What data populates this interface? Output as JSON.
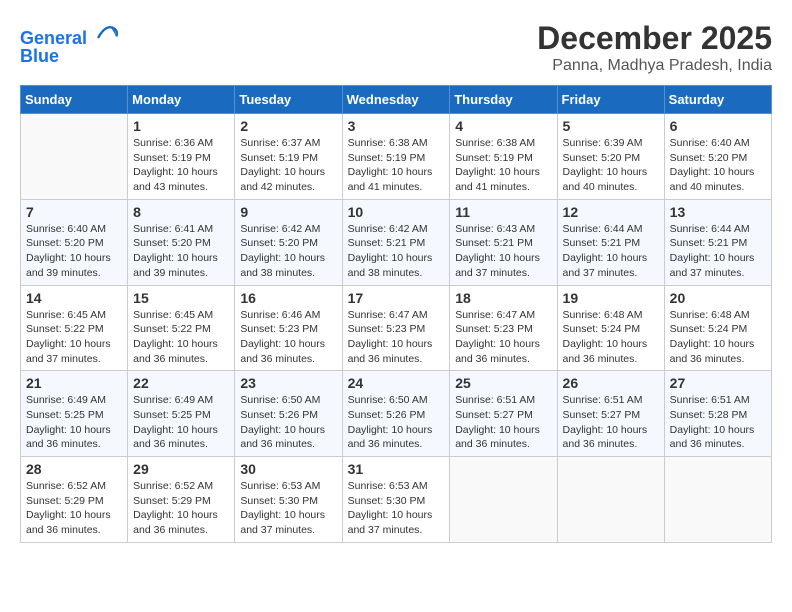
{
  "header": {
    "logo_line1": "General",
    "logo_line2": "Blue",
    "month": "December 2025",
    "location": "Panna, Madhya Pradesh, India"
  },
  "days_of_week": [
    "Sunday",
    "Monday",
    "Tuesday",
    "Wednesday",
    "Thursday",
    "Friday",
    "Saturday"
  ],
  "weeks": [
    [
      {
        "day": "",
        "info": ""
      },
      {
        "day": "1",
        "info": "Sunrise: 6:36 AM\nSunset: 5:19 PM\nDaylight: 10 hours\nand 43 minutes."
      },
      {
        "day": "2",
        "info": "Sunrise: 6:37 AM\nSunset: 5:19 PM\nDaylight: 10 hours\nand 42 minutes."
      },
      {
        "day": "3",
        "info": "Sunrise: 6:38 AM\nSunset: 5:19 PM\nDaylight: 10 hours\nand 41 minutes."
      },
      {
        "day": "4",
        "info": "Sunrise: 6:38 AM\nSunset: 5:19 PM\nDaylight: 10 hours\nand 41 minutes."
      },
      {
        "day": "5",
        "info": "Sunrise: 6:39 AM\nSunset: 5:20 PM\nDaylight: 10 hours\nand 40 minutes."
      },
      {
        "day": "6",
        "info": "Sunrise: 6:40 AM\nSunset: 5:20 PM\nDaylight: 10 hours\nand 40 minutes."
      }
    ],
    [
      {
        "day": "7",
        "info": "Sunrise: 6:40 AM\nSunset: 5:20 PM\nDaylight: 10 hours\nand 39 minutes."
      },
      {
        "day": "8",
        "info": "Sunrise: 6:41 AM\nSunset: 5:20 PM\nDaylight: 10 hours\nand 39 minutes."
      },
      {
        "day": "9",
        "info": "Sunrise: 6:42 AM\nSunset: 5:20 PM\nDaylight: 10 hours\nand 38 minutes."
      },
      {
        "day": "10",
        "info": "Sunrise: 6:42 AM\nSunset: 5:21 PM\nDaylight: 10 hours\nand 38 minutes."
      },
      {
        "day": "11",
        "info": "Sunrise: 6:43 AM\nSunset: 5:21 PM\nDaylight: 10 hours\nand 37 minutes."
      },
      {
        "day": "12",
        "info": "Sunrise: 6:44 AM\nSunset: 5:21 PM\nDaylight: 10 hours\nand 37 minutes."
      },
      {
        "day": "13",
        "info": "Sunrise: 6:44 AM\nSunset: 5:21 PM\nDaylight: 10 hours\nand 37 minutes."
      }
    ],
    [
      {
        "day": "14",
        "info": "Sunrise: 6:45 AM\nSunset: 5:22 PM\nDaylight: 10 hours\nand 37 minutes."
      },
      {
        "day": "15",
        "info": "Sunrise: 6:45 AM\nSunset: 5:22 PM\nDaylight: 10 hours\nand 36 minutes."
      },
      {
        "day": "16",
        "info": "Sunrise: 6:46 AM\nSunset: 5:23 PM\nDaylight: 10 hours\nand 36 minutes."
      },
      {
        "day": "17",
        "info": "Sunrise: 6:47 AM\nSunset: 5:23 PM\nDaylight: 10 hours\nand 36 minutes."
      },
      {
        "day": "18",
        "info": "Sunrise: 6:47 AM\nSunset: 5:23 PM\nDaylight: 10 hours\nand 36 minutes."
      },
      {
        "day": "19",
        "info": "Sunrise: 6:48 AM\nSunset: 5:24 PM\nDaylight: 10 hours\nand 36 minutes."
      },
      {
        "day": "20",
        "info": "Sunrise: 6:48 AM\nSunset: 5:24 PM\nDaylight: 10 hours\nand 36 minutes."
      }
    ],
    [
      {
        "day": "21",
        "info": "Sunrise: 6:49 AM\nSunset: 5:25 PM\nDaylight: 10 hours\nand 36 minutes."
      },
      {
        "day": "22",
        "info": "Sunrise: 6:49 AM\nSunset: 5:25 PM\nDaylight: 10 hours\nand 36 minutes."
      },
      {
        "day": "23",
        "info": "Sunrise: 6:50 AM\nSunset: 5:26 PM\nDaylight: 10 hours\nand 36 minutes."
      },
      {
        "day": "24",
        "info": "Sunrise: 6:50 AM\nSunset: 5:26 PM\nDaylight: 10 hours\nand 36 minutes."
      },
      {
        "day": "25",
        "info": "Sunrise: 6:51 AM\nSunset: 5:27 PM\nDaylight: 10 hours\nand 36 minutes."
      },
      {
        "day": "26",
        "info": "Sunrise: 6:51 AM\nSunset: 5:27 PM\nDaylight: 10 hours\nand 36 minutes."
      },
      {
        "day": "27",
        "info": "Sunrise: 6:51 AM\nSunset: 5:28 PM\nDaylight: 10 hours\nand 36 minutes."
      }
    ],
    [
      {
        "day": "28",
        "info": "Sunrise: 6:52 AM\nSunset: 5:29 PM\nDaylight: 10 hours\nand 36 minutes."
      },
      {
        "day": "29",
        "info": "Sunrise: 6:52 AM\nSunset: 5:29 PM\nDaylight: 10 hours\nand 36 minutes."
      },
      {
        "day": "30",
        "info": "Sunrise: 6:53 AM\nSunset: 5:30 PM\nDaylight: 10 hours\nand 37 minutes."
      },
      {
        "day": "31",
        "info": "Sunrise: 6:53 AM\nSunset: 5:30 PM\nDaylight: 10 hours\nand 37 minutes."
      },
      {
        "day": "",
        "info": ""
      },
      {
        "day": "",
        "info": ""
      },
      {
        "day": "",
        "info": ""
      }
    ]
  ]
}
